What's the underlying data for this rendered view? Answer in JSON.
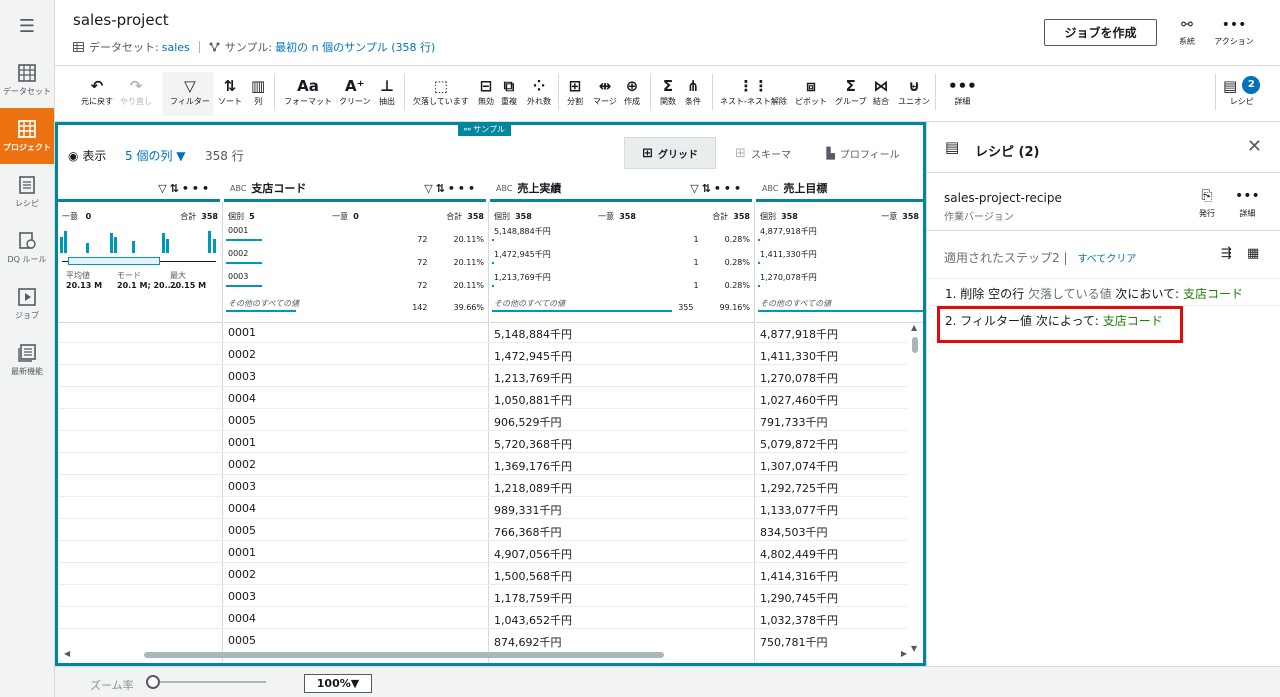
{
  "nav": {
    "items": [
      {
        "label": "データセット"
      },
      {
        "label": "プロジェクト"
      },
      {
        "label": "レシピ"
      },
      {
        "label": "DQ ルール"
      },
      {
        "label": "ジョブ"
      },
      {
        "label": "最新機能"
      }
    ]
  },
  "header": {
    "title": "sales-project",
    "dataset_prefix": "データセット:",
    "dataset_name": "sales",
    "sample_prefix": "サンプル:",
    "sample_value": "最初の n 個のサンプル (358 行)",
    "create_job": "ジョブを作成",
    "lineage": "系統",
    "actions": "アクション"
  },
  "toolbar": {
    "items": [
      "元に戻す",
      "やり直し",
      "フィルター",
      "ソート",
      "列",
      "フォーマット",
      "クリーン",
      "抽出",
      "欠落しています",
      "無効",
      "重複",
      "外れ数",
      "分割",
      "マージ",
      "作成",
      "関数",
      "条件",
      "ネスト-ネスト解除",
      "ピボット",
      "グループ",
      "結合",
      "ユニオン",
      "詳細",
      "レシピ"
    ],
    "recipe_badge": "2"
  },
  "grid": {
    "sample_tag": "サンプル",
    "view_label": "表示",
    "col_count": "5 個の列 ▼",
    "row_count": "358 行",
    "tabs": [
      "グリッド",
      "スキーマ",
      "プロフィール"
    ],
    "columns": [
      {
        "name": "",
        "type": ""
      },
      {
        "name": "支店コード",
        "type": "ABC"
      },
      {
        "name": "売上実績",
        "type": "ABC"
      },
      {
        "name": "売上目標",
        "type": "ABC"
      }
    ],
    "profile": {
      "c0": {
        "unique_label": "一意",
        "unique": "0",
        "total_label": "合計",
        "total": "358",
        "mean_label": "平均値",
        "mean": "20.13 M",
        "mode_label": "モード",
        "mode": "20.1 M; 20....",
        "max_label": "最大",
        "max": "20.15 M"
      },
      "c1": {
        "distinct_label": "個別",
        "distinct": "5",
        "unique_label": "一意",
        "unique": "0",
        "total_label": "合計",
        "total": "358",
        "rows": [
          {
            "v": "0001",
            "n": "72",
            "p": "20.11%"
          },
          {
            "v": "0002",
            "n": "72",
            "p": "20.11%"
          },
          {
            "v": "0003",
            "n": "72",
            "p": "20.11%"
          }
        ],
        "other_label": "その他のすべての値",
        "other_n": "142",
        "other_p": "39.66%"
      },
      "c2": {
        "distinct_label": "個別",
        "distinct": "358",
        "unique_label": "一意",
        "unique": "358",
        "total_label": "合計",
        "total": "358",
        "rows": [
          {
            "v": "5,148,884千円",
            "n": "1",
            "p": "0.28%"
          },
          {
            "v": "1,472,945千円",
            "n": "1",
            "p": "0.28%"
          },
          {
            "v": "1,213,769千円",
            "n": "1",
            "p": "0.28%"
          }
        ],
        "other_label": "その他のすべての値",
        "other_n": "355",
        "other_p": "99.16%"
      },
      "c3": {
        "distinct_label": "個別",
        "distinct": "358",
        "unique_label": "一意",
        "unique": "358",
        "rows": [
          {
            "v": "4,877,918千円"
          },
          {
            "v": "1,411,330千円"
          },
          {
            "v": "1,270,078千円"
          }
        ],
        "other_label": "その他のすべての値"
      }
    },
    "rows": [
      [
        "0001",
        "5,148,884千円",
        "4,877,918千円"
      ],
      [
        "0002",
        "1,472,945千円",
        "1,411,330千円"
      ],
      [
        "0003",
        "1,213,769千円",
        "1,270,078千円"
      ],
      [
        "0004",
        "1,050,881千円",
        "1,027,460千円"
      ],
      [
        "0005",
        "906,529千円",
        "791,733千円"
      ],
      [
        "0001",
        "5,720,368千円",
        "5,079,872千円"
      ],
      [
        "0002",
        "1,369,176千円",
        "1,307,074千円"
      ],
      [
        "0003",
        "1,218,089千円",
        "1,292,725千円"
      ],
      [
        "0004",
        "989,331千円",
        "1,133,077千円"
      ],
      [
        "0005",
        "766,368千円",
        "834,503千円"
      ],
      [
        "0001",
        "4,907,056千円",
        "4,802,449千円"
      ],
      [
        "0002",
        "1,500,568千円",
        "1,414,316千円"
      ],
      [
        "0003",
        "1,178,759千円",
        "1,290,745千円"
      ],
      [
        "0004",
        "1,043,652千円",
        "1,032,378千円"
      ],
      [
        "0005",
        "874,692千円",
        "750,781千円"
      ]
    ]
  },
  "recipe": {
    "title": "レシピ (2)",
    "name": "sales-project-recipe",
    "version": "作業バージョン",
    "publish": "発行",
    "details": "詳細",
    "applied_steps": "適用されたステップ2 |",
    "clear_all": "すべてクリア",
    "step1": {
      "a": "1. 削除",
      "b": "空の行",
      "c": "欠落している値",
      "d": "次において:",
      "e": "支店コード"
    },
    "step2": {
      "a": "2. フィルター値",
      "b": "次によって:",
      "c": "支店コード"
    }
  },
  "footer": {
    "zoom_label": "ズーム率",
    "zoom_value": "100%▼"
  }
}
